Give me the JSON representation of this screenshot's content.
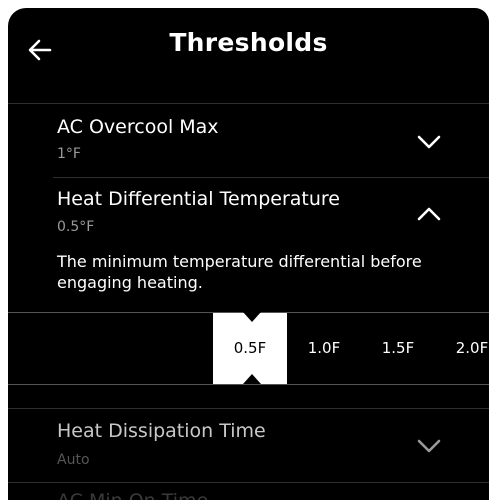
{
  "header": {
    "title": "Thresholds",
    "back_icon": "arrow-left-icon"
  },
  "settings": [
    {
      "label": "AC Overcool Max",
      "value": "1°F",
      "expanded": false
    },
    {
      "label": "Heat Differential Temperature",
      "value": "0.5°F",
      "expanded": true,
      "description": "The minimum temperature differential before engaging heating.",
      "options": [
        "0.5F",
        "1.0F",
        "1.5F",
        "2.0F"
      ],
      "selected": "0.5F"
    },
    {
      "label": "Heat Dissipation Time",
      "value": "Auto",
      "expanded": false
    },
    {
      "label": "AC Min On Time",
      "partially_visible": true
    }
  ],
  "colors": {
    "background": "#000000",
    "text": "#ffffff",
    "subtext": "#9a9a9a",
    "selected_bg": "#ffffff"
  }
}
